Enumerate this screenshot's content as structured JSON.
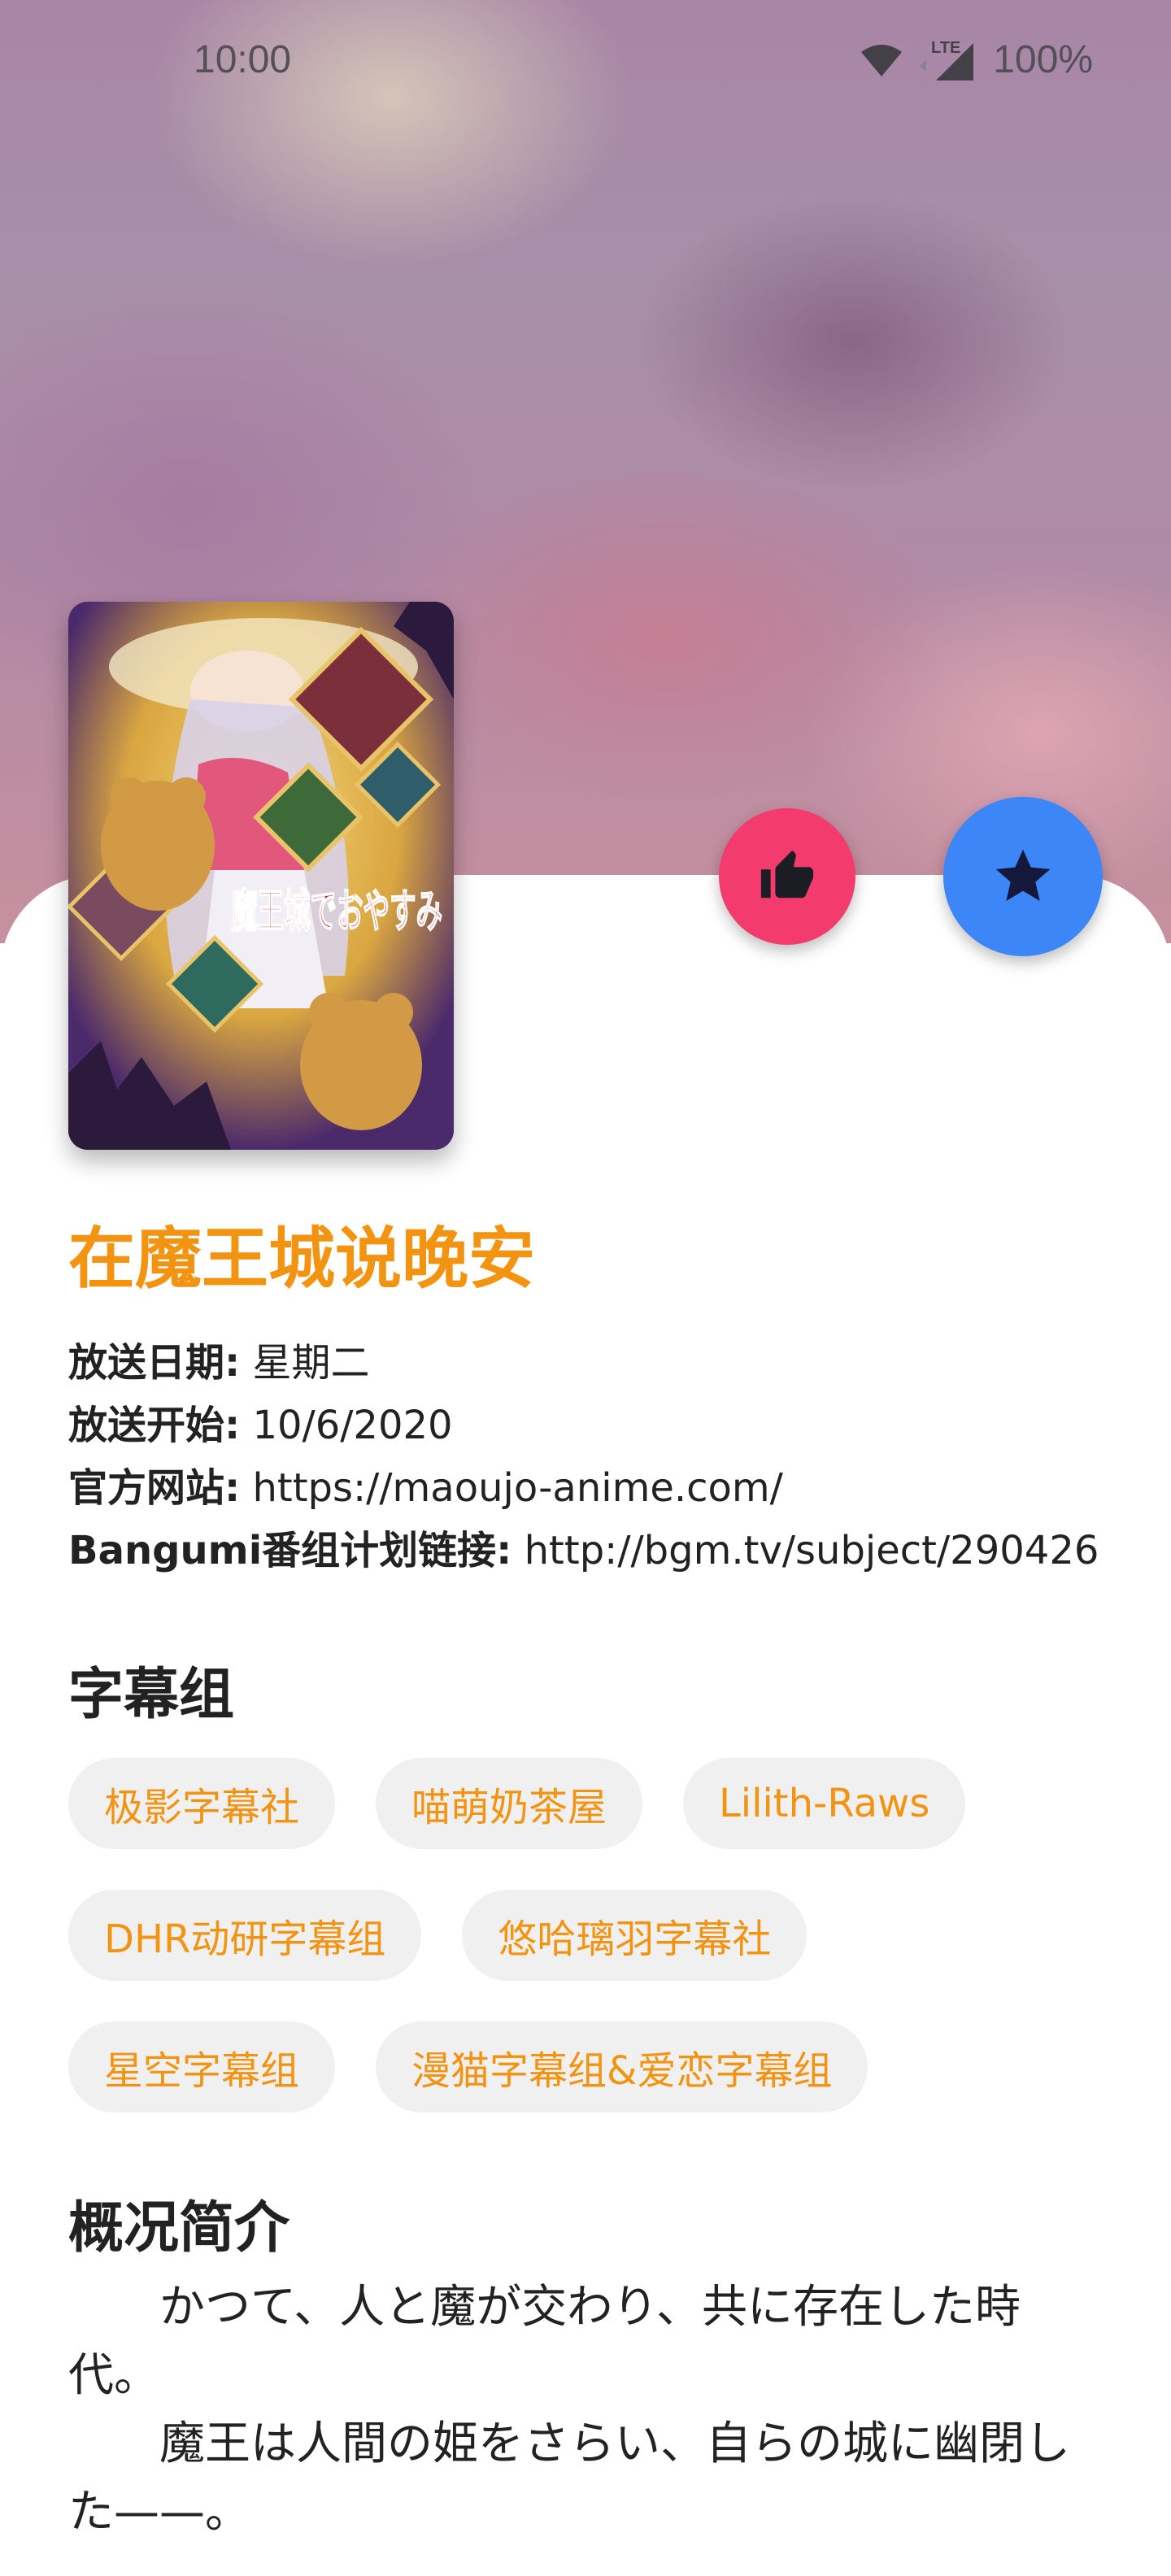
{
  "status_bar": {
    "time": "10:00",
    "network": "LTE",
    "battery": "100%"
  },
  "anime": {
    "title": "在魔王城说晚安",
    "cover_text": "魔王城でおやすみ"
  },
  "info": [
    {
      "label": "放送日期:",
      "value": "星期二"
    },
    {
      "label": "放送开始:",
      "value": "10/6/2020"
    },
    {
      "label": "官方网站:",
      "value": "https://maoujo-anime.com/"
    },
    {
      "label": "Bangumi番组计划链接:",
      "value": "http://bgm.tv/subject/290426"
    }
  ],
  "subtitle_groups": {
    "heading": "字幕组",
    "rows": [
      [
        "极影字幕社",
        "喵萌奶茶屋",
        "Lilith-Raws"
      ],
      [
        "DHR动研字幕组",
        "悠哈璃羽字幕社"
      ],
      [
        "星空字幕组",
        "漫猫字幕组&爱恋字幕组"
      ]
    ]
  },
  "synopsis": {
    "heading": "概况简介",
    "paragraphs": [
      "かつて、人と魔が交わり、共に存在した時代。",
      "魔王は人間の姫をさらい、自らの城に幽閉した——。"
    ]
  },
  "colors": {
    "accent": "#f29312",
    "like_button": "#f43b6e",
    "favorite_button": "#3d86f8",
    "chip_background": "#f0f0f0",
    "text": "#222222"
  },
  "icons": {
    "like": "thumb-up-icon",
    "favorite": "star-icon",
    "wifi": "wifi-icon",
    "signal": "signal-icon"
  }
}
